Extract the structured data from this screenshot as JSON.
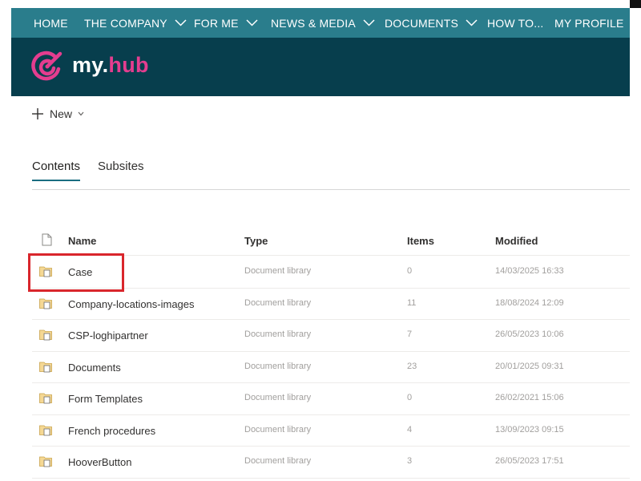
{
  "nav": {
    "items": [
      {
        "label": "HOME",
        "dropdown": false
      },
      {
        "label": "THE COMPANY",
        "dropdown": true
      },
      {
        "label": "FOR ME",
        "dropdown": true
      },
      {
        "label": "NEWS & MEDIA",
        "dropdown": true
      },
      {
        "label": "DOCUMENTS",
        "dropdown": true
      },
      {
        "label": "HOW TO...",
        "dropdown": false
      },
      {
        "label": "MY PROFILE",
        "dropdown": false
      }
    ]
  },
  "brand": {
    "name_prefix": "my.",
    "name_suffix": "hub",
    "accent_color": "#e43d8f",
    "banner_color": "#073e4d",
    "nav_color": "#2a7d8c"
  },
  "command_bar": {
    "new_label": "New",
    "new_icon": "plus-icon",
    "caret_icon": "chevron-down-icon"
  },
  "tabs": [
    {
      "label": "Contents",
      "active": true
    },
    {
      "label": "Subsites",
      "active": false
    }
  ],
  "list": {
    "columns": {
      "name": "Name",
      "type": "Type",
      "items": "Items",
      "modified": "Modified"
    },
    "header_icon": "document-icon",
    "rows": [
      {
        "name": "Case",
        "type": "Document library",
        "items": "0",
        "modified": "14/03/2025 16:33",
        "highlighted": true
      },
      {
        "name": "Company-locations-images",
        "type": "Document library",
        "items": "11",
        "modified": "18/08/2024 12:09"
      },
      {
        "name": "CSP-loghipartner",
        "type": "Document library",
        "items": "7",
        "modified": "26/05/2023 10:06"
      },
      {
        "name": "Documents",
        "type": "Document library",
        "items": "23",
        "modified": "20/01/2025 09:31"
      },
      {
        "name": "Form Templates",
        "type": "Document library",
        "items": "0",
        "modified": "26/02/2021 15:06"
      },
      {
        "name": "French procedures",
        "type": "Document library",
        "items": "4",
        "modified": "13/09/2023 09:15"
      },
      {
        "name": "HooverButton",
        "type": "Document library",
        "items": "3",
        "modified": "26/05/2023 17:51"
      }
    ]
  }
}
